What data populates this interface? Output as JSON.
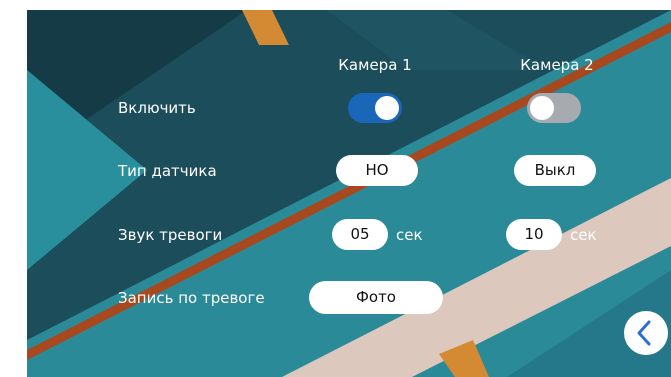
{
  "columns": {
    "camera1": "Камера 1",
    "camera2": "Камера 2"
  },
  "rows": {
    "enable": {
      "label": "Включить",
      "camera1_on": true,
      "camera2_on": false
    },
    "sensor_type": {
      "label": "Тип датчика",
      "camera1_value": "НО",
      "camera2_value": "Выкл"
    },
    "alarm_sound": {
      "label": "Звук тревоги",
      "camera1_value": "05",
      "camera2_value": "10",
      "unit": "сек"
    },
    "alarm_record": {
      "label": "Запись по тревоге",
      "value": "Фото"
    }
  },
  "icons": {
    "back": "chevron-left-icon"
  },
  "colors": {
    "toggle_on": "#1a66b8",
    "toggle_off": "#a7abb0",
    "accent": "#2b6fd6"
  }
}
